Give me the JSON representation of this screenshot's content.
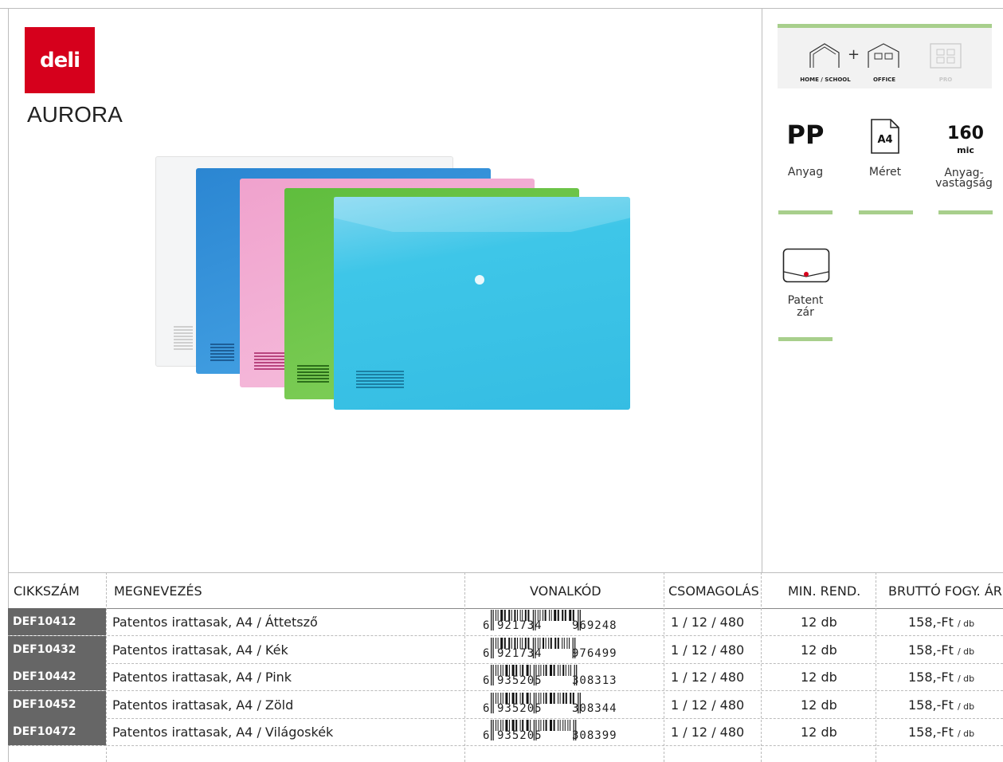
{
  "brand": {
    "logo_text": "deli",
    "logo_color": "#d6001c"
  },
  "product": {
    "title": "AURORA"
  },
  "usage": {
    "items": [
      {
        "label": "HOME / SCHOOL",
        "icon": "house-icon",
        "active": true
      },
      {
        "label": "OFFICE",
        "icon": "office-building-icon",
        "active": true
      },
      {
        "label": "PRO",
        "icon": "factory-icon",
        "active": false
      }
    ],
    "plus": "+"
  },
  "specs": {
    "material": {
      "value": "PP",
      "label": "Anyag"
    },
    "size": {
      "value": "A4",
      "label": "Méret"
    },
    "thickness": {
      "value": "160",
      "unit": "mic",
      "label_line1": "Anyag-",
      "label_line2": "vastagság"
    },
    "closure": {
      "label_line1": "Patent",
      "label_line2": "zár"
    }
  },
  "colors": {
    "accent_green": "#a8cf8c",
    "code_bg": "#666666",
    "folders": [
      "#f4f4f4",
      "#2f8fd6",
      "#f2a6cf",
      "#6cc24a",
      "#3ec6e8"
    ]
  },
  "table": {
    "headers": [
      "CIKKSZÁM",
      "MEGNEVEZÉS",
      "VONALKÓD",
      "CSOMAGOLÁS",
      "MIN. REND.",
      "BRUTTÓ FOGY. ÁR"
    ],
    "rows": [
      {
        "code": "DEF10412",
        "name": "Patentos irattasak, A4 / Áttetsző",
        "barcode_prefix": "6",
        "barcode_left": "921734",
        "barcode_right": "969248",
        "packaging": "1 / 12 / 480",
        "min_order": "12 db",
        "price": "158,-Ft",
        "price_unit": "/ db"
      },
      {
        "code": "DEF10432",
        "name": "Patentos irattasak, A4 / Kék",
        "barcode_prefix": "6",
        "barcode_left": "921734",
        "barcode_right": "976499",
        "packaging": "1 / 12 / 480",
        "min_order": "12 db",
        "price": "158,-Ft",
        "price_unit": "/ db"
      },
      {
        "code": "DEF10442",
        "name": "Patentos irattasak, A4 / Pink",
        "barcode_prefix": "6",
        "barcode_left": "935205",
        "barcode_right": "308313",
        "packaging": "1 / 12 / 480",
        "min_order": "12 db",
        "price": "158,-Ft",
        "price_unit": "/ db"
      },
      {
        "code": "DEF10452",
        "name": "Patentos irattasak, A4 / Zöld",
        "barcode_prefix": "6",
        "barcode_left": "935205",
        "barcode_right": "308344",
        "packaging": "1 / 12 / 480",
        "min_order": "12 db",
        "price": "158,-Ft",
        "price_unit": "/ db"
      },
      {
        "code": "DEF10472",
        "name": "Patentos irattasak, A4 / Világoskék",
        "barcode_prefix": "6",
        "barcode_left": "935205",
        "barcode_right": "308399",
        "packaging": "1 / 12 / 480",
        "min_order": "12 db",
        "price": "158,-Ft",
        "price_unit": "/ db"
      }
    ]
  }
}
